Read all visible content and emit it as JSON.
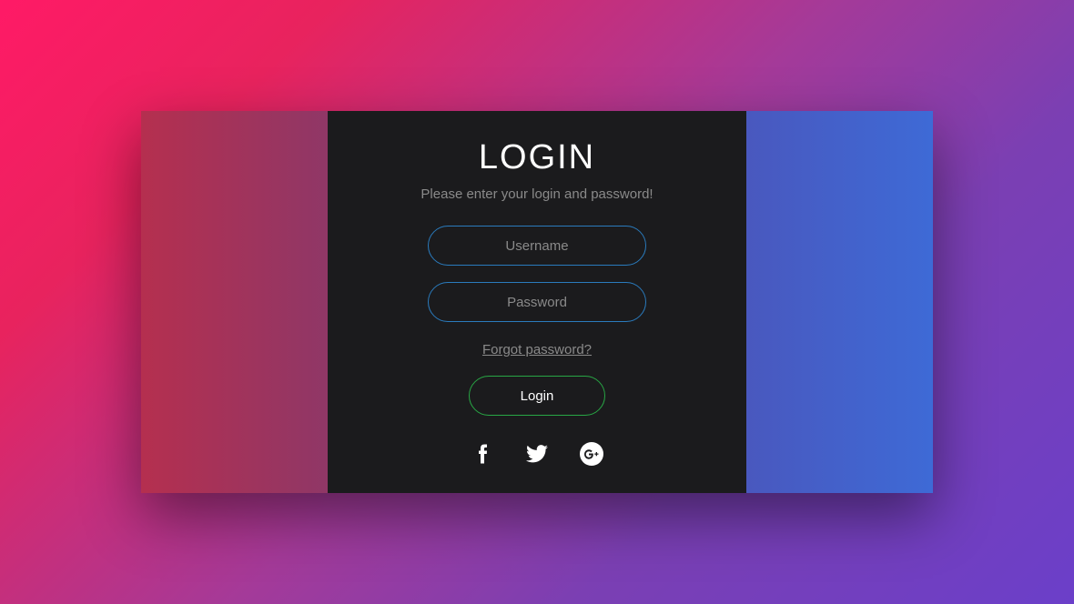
{
  "login": {
    "title": "LOGIN",
    "subtitle": "Please enter your login and password!",
    "username_placeholder": "Username",
    "password_placeholder": "Password",
    "forgot_label": "Forgot password?",
    "submit_label": "Login"
  },
  "social": {
    "facebook": "facebook-icon",
    "twitter": "twitter-icon",
    "googleplus": "googleplus-icon"
  },
  "colors": {
    "input_border": "#2a7bbd",
    "button_border": "#28a745",
    "card_bg": "#1b1b1d",
    "text_muted": "#8a8a8a"
  }
}
